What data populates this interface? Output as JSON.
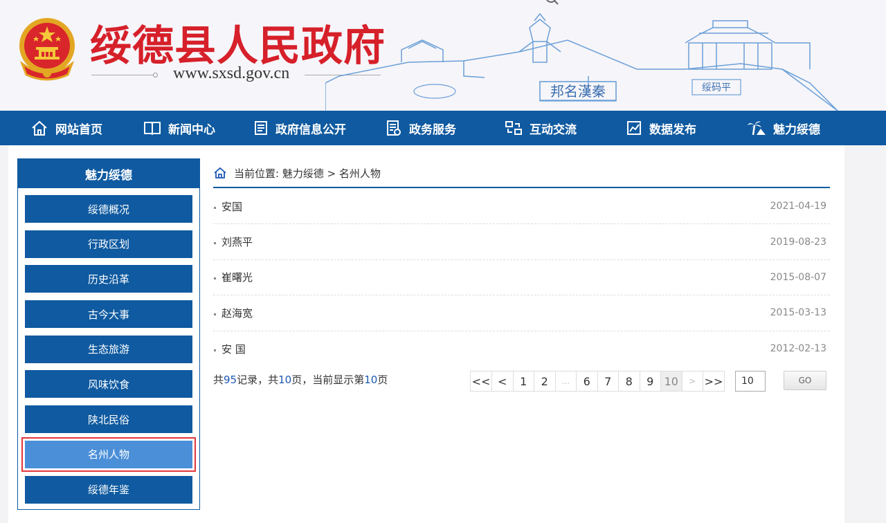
{
  "header": {
    "site_title": "绥德县人民政府",
    "site_url": "www.sxsd.gov.cn",
    "skyline_sign_1": "邦名漢秦",
    "skyline_sign_2": "绥码平"
  },
  "nav": {
    "items": [
      {
        "label": "网站首页",
        "icon": "home-icon"
      },
      {
        "label": "新闻中心",
        "icon": "book-icon"
      },
      {
        "label": "政府信息公开",
        "icon": "document-icon"
      },
      {
        "label": "政务服务",
        "icon": "service-list-icon"
      },
      {
        "label": "互动交流",
        "icon": "interaction-icon"
      },
      {
        "label": "数据发布",
        "icon": "chart-icon"
      },
      {
        "label": "魅力绥德",
        "icon": "palm-tree-icon"
      }
    ]
  },
  "sidebar": {
    "title": "魅力绥德",
    "items": [
      {
        "label": "绥德概况"
      },
      {
        "label": "行政区划"
      },
      {
        "label": "历史沿革"
      },
      {
        "label": "古今大事"
      },
      {
        "label": "生态旅游"
      },
      {
        "label": "风味饮食"
      },
      {
        "label": "陕北民俗"
      },
      {
        "label": "名州人物",
        "active": true
      },
      {
        "label": "绥德年鉴"
      }
    ]
  },
  "breadcrumb": {
    "text": "当前位置: 魅力绥德 > 名州人物"
  },
  "articles": [
    {
      "title": "安国",
      "date": "2021-04-19"
    },
    {
      "title": "刘燕平",
      "date": "2019-08-23"
    },
    {
      "title": "崔曙光",
      "date": "2015-08-07"
    },
    {
      "title": "赵海宽",
      "date": "2015-03-13"
    },
    {
      "title": "安 国",
      "date": "2012-02-13"
    }
  ],
  "pagination": {
    "prefix": "共",
    "total_records": "95",
    "records_text": "记录，共",
    "total_pages": "10",
    "pages_text": "页，当前显示第",
    "current_page": "10",
    "suffix": "页",
    "first": "<<",
    "prev": "<",
    "pages": [
      "1",
      "2",
      "...",
      "6",
      "7",
      "8",
      "9",
      "10"
    ],
    "next": ">",
    "last": ">>",
    "input_value": "10",
    "go_label": "GO"
  }
}
